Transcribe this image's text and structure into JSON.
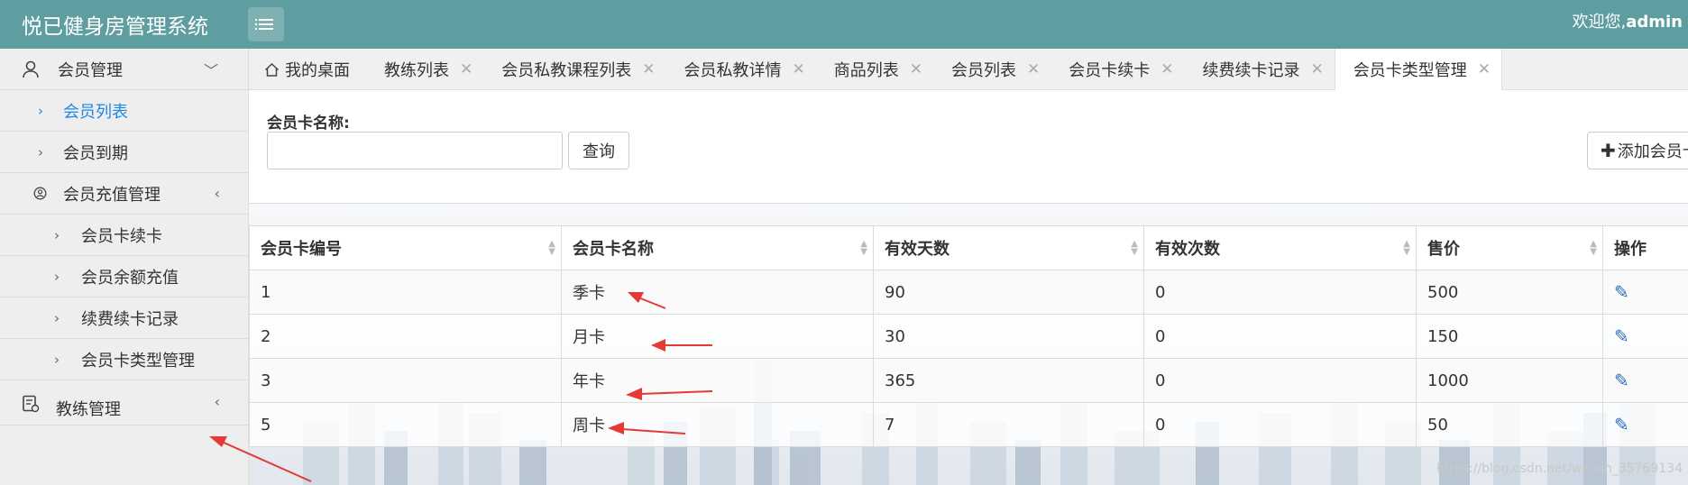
{
  "header": {
    "title": "悦已健身房管理系统",
    "welcome_prefix": "欢迎您,",
    "welcome_user": "admin"
  },
  "sidebar": {
    "member_mgmt": "会员管理",
    "member_list": "会员列表",
    "member_expire": "会员到期",
    "recharge_mgmt": "会员充值管理",
    "renew_card": "会员卡续卡",
    "balance_recharge": "会员余额充值",
    "renew_records": "续费续卡记录",
    "card_type_mgmt": "会员卡类型管理",
    "coach_mgmt": "教练管理"
  },
  "tabs": [
    {
      "label": "我的桌面"
    },
    {
      "label": "教练列表"
    },
    {
      "label": "会员私教课程列表"
    },
    {
      "label": "会员私教详情"
    },
    {
      "label": "商品列表"
    },
    {
      "label": "会员列表"
    },
    {
      "label": "会员卡续卡"
    },
    {
      "label": "续费续卡记录"
    },
    {
      "label": "会员卡类型管理"
    }
  ],
  "search": {
    "label": "会员卡名称:",
    "value": "",
    "query_button": "查询",
    "add_button": "添加会员卡"
  },
  "table": {
    "headers": [
      "会员卡编号",
      "会员卡名称",
      "有效天数",
      "有效次数",
      "售价",
      "操作"
    ],
    "rows": [
      [
        "1",
        "季卡",
        "90",
        "0",
        "500"
      ],
      [
        "2",
        "月卡",
        "30",
        "0",
        "150"
      ],
      [
        "3",
        "年卡",
        "365",
        "0",
        "1000"
      ],
      [
        "5",
        "周卡",
        "7",
        "0",
        "50"
      ]
    ]
  },
  "watermark": "https://blog.csdn.net/weixin_35769134",
  "colors": {
    "header": "#5f9ea0",
    "active_link": "#1e88e5",
    "annotation_arrow": "#e53935"
  },
  "icons": {
    "home": "home-icon",
    "user": "user-icon",
    "recharge": "recharge-icon",
    "coach": "coach-icon",
    "edit": "edit-icon",
    "menu": "menu-icon"
  }
}
